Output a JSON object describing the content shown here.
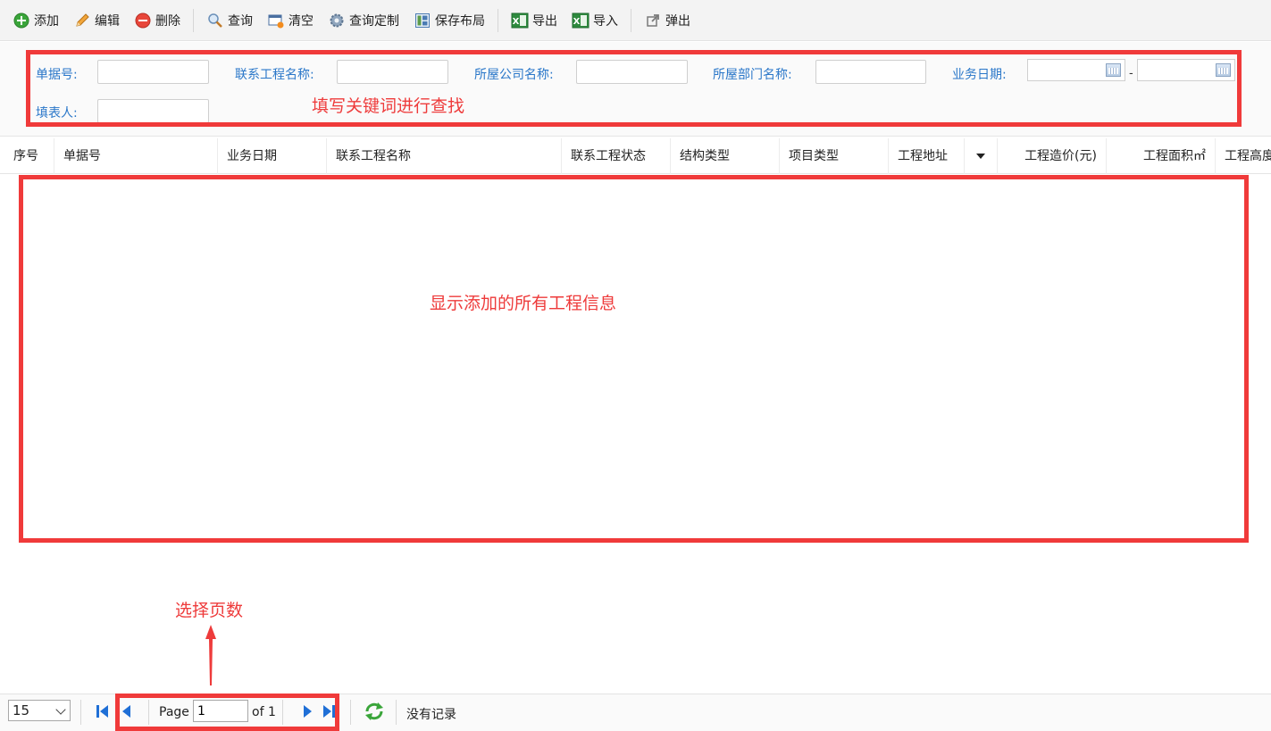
{
  "toolbar": {
    "add": "添加",
    "edit": "编辑",
    "delete": "删除",
    "query": "查询",
    "clear": "清空",
    "query_custom": "查询定制",
    "save_layout": "保存布局",
    "export": "导出",
    "import": "导入",
    "popup": "弹出"
  },
  "search": {
    "doc_no_label": "单据号:",
    "project_name_label": "联系工程名称:",
    "company_label": "所屋公司名称:",
    "department_label": "所屋部门名称:",
    "biz_date_label": "业务日期:",
    "filler_label": "填表人:",
    "date_dash": "-",
    "doc_no_value": "",
    "project_name_value": "",
    "company_value": "",
    "department_value": "",
    "date_from_value": "",
    "date_to_value": "",
    "filler_value": ""
  },
  "grid": {
    "columns": [
      "序号",
      "单据号",
      "业务日期",
      "联系工程名称",
      "联系工程状态",
      "结构类型",
      "项目类型",
      "工程地址",
      "工程造价(元)",
      "工程面积㎡",
      "工程高度"
    ]
  },
  "annotations": {
    "search_hint": "填写关键词进行查找",
    "grid_hint": "显示添加的所有工程信息",
    "pager_hint": "选择页数"
  },
  "pager": {
    "page_size": "15",
    "page_label": "Page",
    "page_value": "1",
    "of_label": "of 1",
    "status": "没有记录"
  },
  "colors": {
    "label_blue": "#2a77c9",
    "annotation_red": "#ee3b3b",
    "pager_arrow_blue": "#1f6fd6",
    "refresh_green": "#3aa53a"
  }
}
